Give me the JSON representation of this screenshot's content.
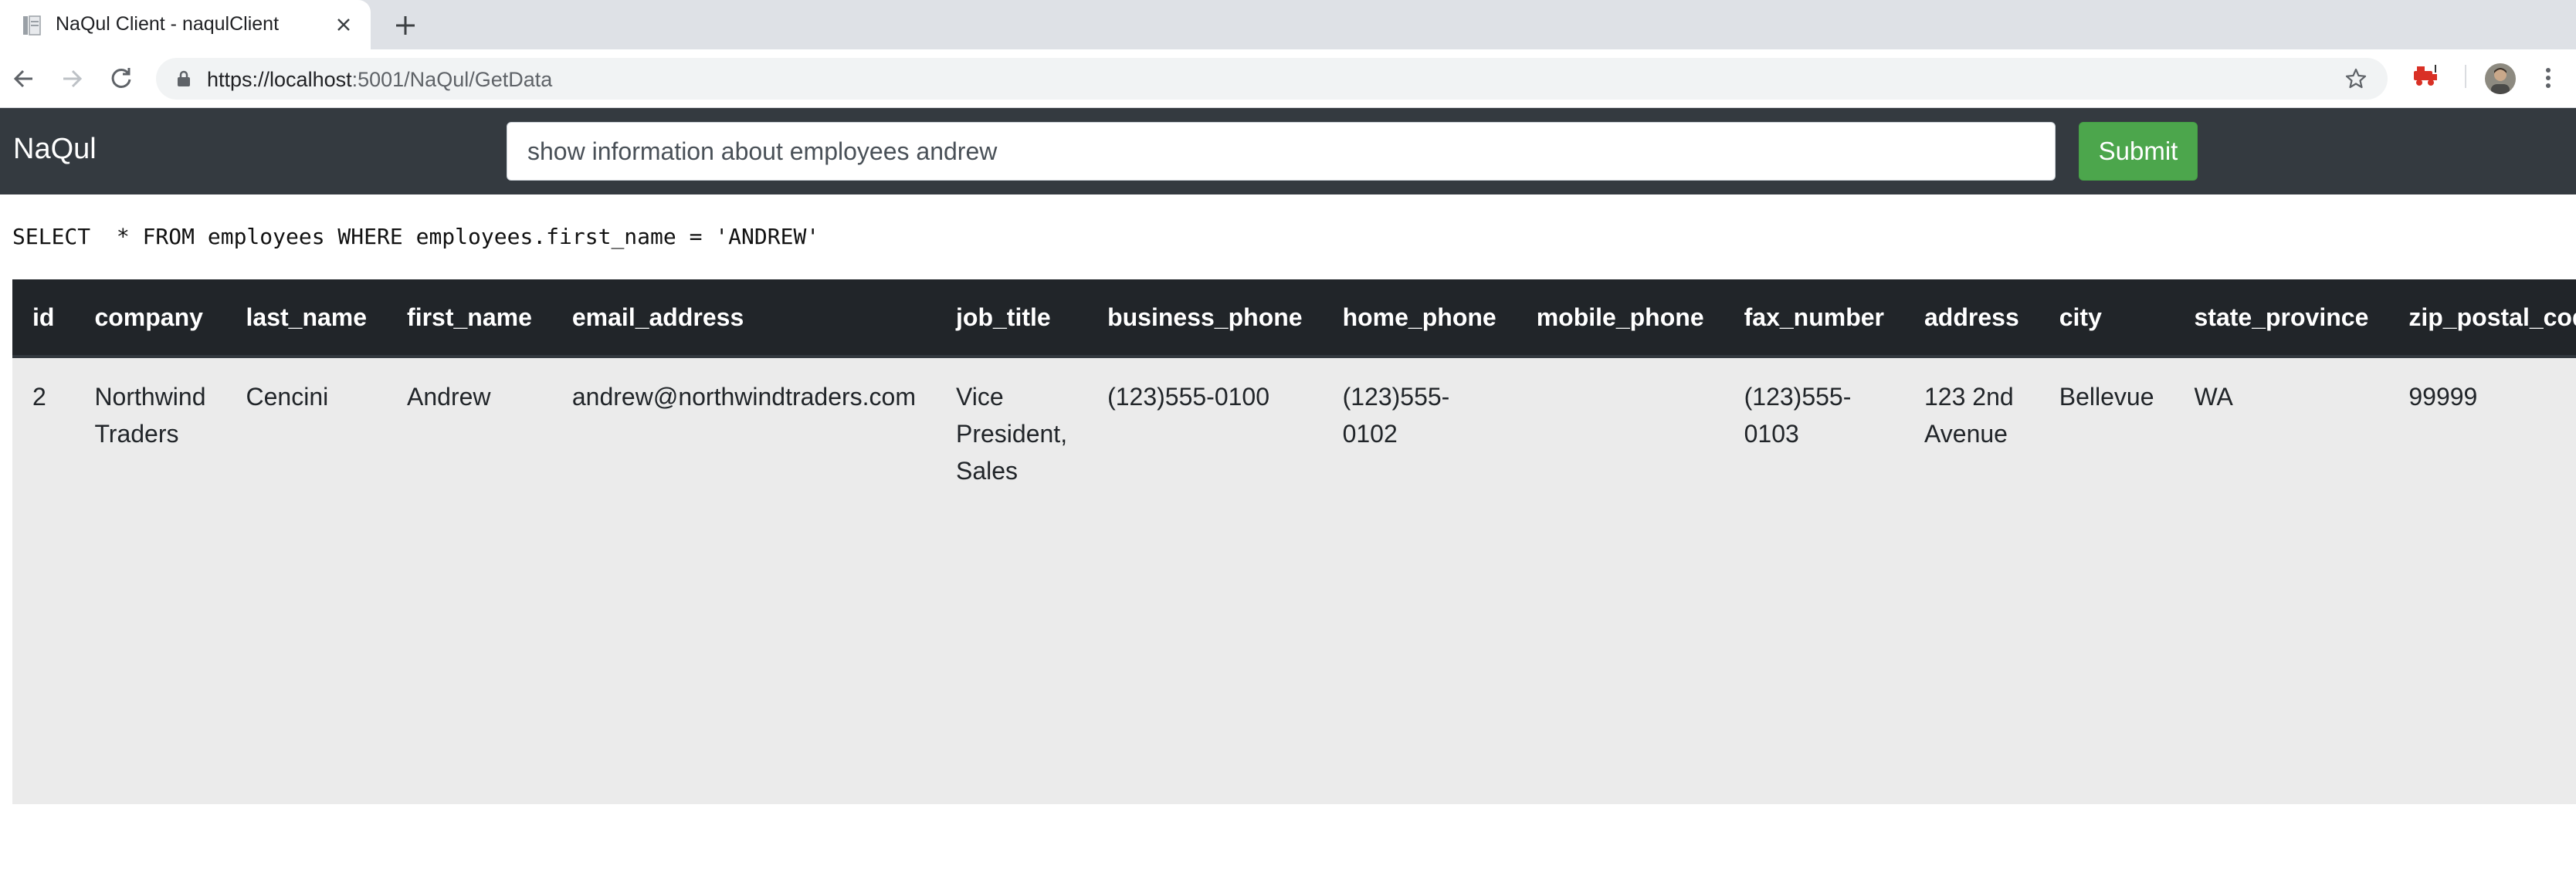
{
  "browser": {
    "tab_title": "NaQul Client - naqulClient",
    "url_host": "https://localhost",
    "url_path": ":5001/NaQul/GetData"
  },
  "icons": {
    "tab_favicon": "page-icon",
    "tab_close": "close-icon",
    "new_tab": "plus-icon",
    "back": "arrow-left-icon",
    "forward": "arrow-right-icon",
    "reload": "reload-icon",
    "lock": "lock-icon",
    "bookmark": "star-icon",
    "extension": "extension-icon",
    "profile": "avatar",
    "menu": "vertical-dots-icon"
  },
  "app": {
    "brand": "NaQul",
    "query_value": "show information about employees andrew",
    "submit_label": "Submit",
    "accent_color": "#4ca64c",
    "navbar_color": "#343a40"
  },
  "sql": "SELECT  * FROM employees WHERE employees.first_name = 'ANDREW'",
  "table": {
    "columns": [
      "id",
      "company",
      "last_name",
      "first_name",
      "email_address",
      "job_title",
      "business_phone",
      "home_phone",
      "mobile_phone",
      "fax_number",
      "address",
      "city",
      "state_province",
      "zip_postal_code"
    ],
    "rows": [
      [
        "2",
        "Northwind Traders",
        "Cencini",
        "Andrew",
        "andrew@northwindtraders.com",
        "Vice President, Sales",
        "(123)555-0100",
        "(123)555-0102",
        "",
        "(123)555-0103",
        "123 2nd Avenue",
        "Bellevue",
        "WA",
        "99999"
      ]
    ]
  }
}
